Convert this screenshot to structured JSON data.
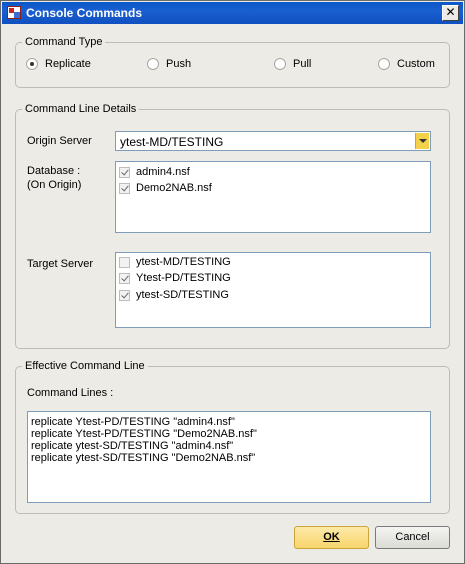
{
  "window": {
    "title": "Console Commands"
  },
  "command_type": {
    "label": "Command Type",
    "options": [
      {
        "label": "Replicate",
        "selected": true
      },
      {
        "label": "Push",
        "selected": false
      },
      {
        "label": "Pull",
        "selected": false
      },
      {
        "label": "Custom",
        "selected": false
      }
    ]
  },
  "details": {
    "label": "Command Line Details",
    "origin_label": "Origin Server",
    "origin_value": "ytest-MD/TESTING",
    "database_label": "Database :",
    "database_sublabel": "(On Origin)",
    "databases": [
      {
        "label": "admin4.nsf",
        "checked": true
      },
      {
        "label": "Demo2NAB.nsf",
        "checked": true
      }
    ],
    "target_label": "Target Server",
    "targets": [
      {
        "label": "ytest-MD/TESTING",
        "checked": false
      },
      {
        "label": "Ytest-PD/TESTING",
        "checked": true
      },
      {
        "label": "ytest-SD/TESTING",
        "checked": true
      }
    ]
  },
  "effective": {
    "label": "Effective Command Line",
    "lines_label": "Command Lines :",
    "lines": [
      "replicate Ytest-PD/TESTING \"admin4.nsf\"",
      "replicate Ytest-PD/TESTING \"Demo2NAB.nsf\"",
      "replicate ytest-SD/TESTING \"admin4.nsf\"",
      "replicate ytest-SD/TESTING \"Demo2NAB.nsf\""
    ]
  },
  "buttons": {
    "ok": "OK",
    "cancel": "Cancel"
  }
}
